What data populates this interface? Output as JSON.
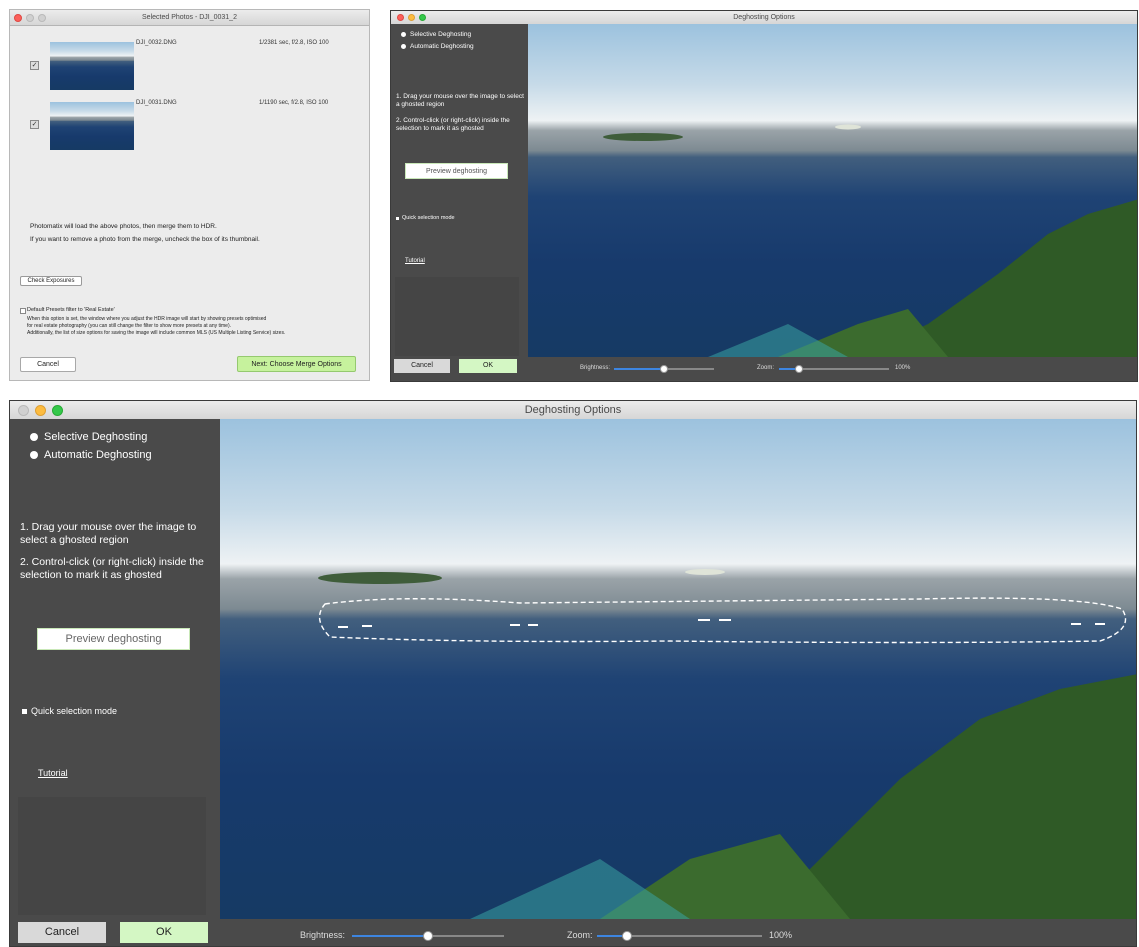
{
  "photos_window": {
    "title": "Selected Photos - DJI_0031_2",
    "photos": [
      {
        "name": "DJI_0032.DNG",
        "exposure": "1/2381 sec, f/2.8, ISO 100"
      },
      {
        "name": "DJI_0031.DNG",
        "exposure": "1/1190 sec, f/2.8, ISO 100"
      }
    ],
    "info_line1": "Photomatix will load the above photos, then merge them to HDR.",
    "info_line2": "If you want to remove a photo from the merge, uncheck the box of its thumbnail.",
    "check_exposures": "Check Exposures",
    "default_presets_label": "Default Presets filter to 'Real Estate'",
    "desc_line1": "When this option is set, the window where you adjust the HDR image will start by showing presets optimised",
    "desc_line2": "for real estate photography (you can still change the filter to show more presets at any time).",
    "desc_line3": "Additionally, the list of size options for saving the image will include common MLS (US Multiple Listing Service) sizes.",
    "cancel": "Cancel",
    "next": "Next: Choose Merge Options"
  },
  "deghost_window": {
    "title": "Deghosting Options",
    "selective": "Selective Deghosting",
    "automatic": "Automatic Deghosting",
    "step1": "1. Drag your mouse over the image to select a ghosted region",
    "step2": "2. Control-click (or right-click) inside the selection to mark it as ghosted",
    "preview": "Preview deghosting",
    "quick_selection": "Quick selection mode",
    "tutorial": "Tutorial",
    "cancel": "Cancel",
    "ok": "OK",
    "brightness_label": "Brightness:",
    "zoom_label": "Zoom:",
    "zoom_value": "100%",
    "brightness_level": 0.5,
    "zoom_level": 0.18
  },
  "colors": {
    "panel": "#4a4a4a",
    "ok_green": "#d4f7c4",
    "slider_blue": "#3d85e0"
  }
}
